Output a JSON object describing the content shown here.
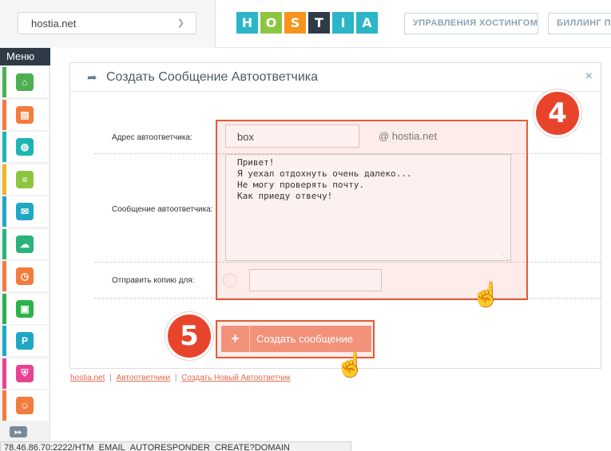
{
  "header": {
    "domain_select": "hostia.net",
    "logo_letters": [
      "H",
      "O",
      "S",
      "T",
      "I",
      "A"
    ],
    "logo_colors": [
      "#2bb5c8",
      "#8cc63f",
      "#f7941d",
      "#2e3b46",
      "#2bb5c8",
      "#2bb5c8"
    ],
    "nav_buttons": [
      "УПРАВЛЕНИЯ ХОСТИНГОМ",
      "БИЛЛИНГ П"
    ]
  },
  "sidebar": {
    "title": "Меню",
    "items": [
      {
        "icon": "home-icon",
        "color": "#4caf50",
        "accent": "#4caf50"
      },
      {
        "icon": "folder-icon",
        "color": "#f47b3e",
        "accent": "#f47b3e"
      },
      {
        "icon": "www-icon",
        "color": "#1fb3b3",
        "accent": "#1fb3b3"
      },
      {
        "icon": "database-icon",
        "color": "#8cc63f",
        "accent": "#f0b323"
      },
      {
        "icon": "mail-icon",
        "color": "#1fa7c4",
        "accent": "#1fa7c4"
      },
      {
        "icon": "ftp-icon",
        "color": "#2ab27b",
        "accent": "#2ab27b"
      },
      {
        "icon": "clock-icon",
        "color": "#f47b3e",
        "accent": "#f47b3e"
      },
      {
        "icon": "tv-icon",
        "color": "#2ab24b",
        "accent": "#2ab24b"
      },
      {
        "icon": "php-icon",
        "color": "#1fa7c4",
        "accent": "#1fa7c4"
      },
      {
        "icon": "shield-icon",
        "color": "#e84393",
        "accent": "#e84393"
      },
      {
        "icon": "user-settings-icon",
        "color": "#f47b3e",
        "accent": "#f47b3e"
      }
    ],
    "more": "▸▸"
  },
  "panel": {
    "title": "Создать Сообщение Автоответчика",
    "close": "×",
    "address_label": "Адрес автоответчика:",
    "address_value": "box",
    "address_domain": "@ hostia.net",
    "message_label": "Сообщение автоответчика:",
    "message_value": "Привет!\nЯ уехал отдохнуть очень далеко...\nНе могу проверять почту.\nКак приеду отвечу!",
    "copy_label": "Отправить копию для:",
    "copy_value": "",
    "create_button": "Создать сообщение",
    "create_plus": "+"
  },
  "badges": {
    "step4": "4",
    "step5": "5"
  },
  "breadcrumb": {
    "home": "hostia.net",
    "section": "Автоответчики",
    "current": "Создать Новый Автоответчик"
  },
  "status_bar": "78.46.86.70:2222/HTM_EMAIL_AUTORESPONDER_CREATE?DOMAIN"
}
